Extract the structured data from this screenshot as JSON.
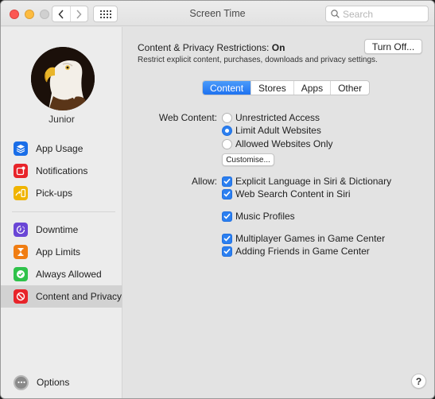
{
  "window": {
    "title": "Screen Time",
    "search_placeholder": "Search",
    "search_value": ""
  },
  "sidebar": {
    "user_name": "Junior",
    "items": [
      {
        "label": "App Usage",
        "icon": "app-usage-icon",
        "color": "#1a6ee8"
      },
      {
        "label": "Notifications",
        "icon": "notifications-icon",
        "color": "#e8242a"
      },
      {
        "label": "Pick-ups",
        "icon": "pickups-icon",
        "color": "#f0b400"
      },
      {
        "label": "Downtime",
        "icon": "downtime-icon",
        "color": "#6a46d6"
      },
      {
        "label": "App Limits",
        "icon": "app-limits-icon",
        "color": "#f07d12"
      },
      {
        "label": "Always Allowed",
        "icon": "always-allowed-icon",
        "color": "#2fc24a"
      },
      {
        "label": "Content and Privacy",
        "icon": "content-privacy-icon",
        "color": "#e8242a",
        "selected": true
      }
    ],
    "options_label": "Options"
  },
  "main": {
    "restrictions_label": "Content & Privacy Restrictions:",
    "restrictions_state": "On",
    "restrictions_desc": "Restrict explicit content, purchases, downloads and privacy settings.",
    "turn_off_label": "Turn Off...",
    "tabs": [
      {
        "label": "Content",
        "active": true
      },
      {
        "label": "Stores"
      },
      {
        "label": "Apps"
      },
      {
        "label": "Other"
      }
    ],
    "web_content_label": "Web Content:",
    "web_content_options": [
      {
        "label": "Unrestricted Access",
        "selected": false
      },
      {
        "label": "Limit Adult Websites",
        "selected": true
      },
      {
        "label": "Allowed Websites Only",
        "selected": false
      }
    ],
    "customise_label": "Customise...",
    "allow_label": "Allow:",
    "allow_options": [
      {
        "label": "Explicit Language in Siri & Dictionary",
        "checked": true
      },
      {
        "label": "Web Search Content in Siri",
        "checked": true
      },
      {
        "label": "Music Profiles",
        "checked": true
      },
      {
        "label": "Multiplayer Games in Game Center",
        "checked": true
      },
      {
        "label": "Adding Friends in Game Center",
        "checked": true
      }
    ],
    "help_label": "?"
  }
}
